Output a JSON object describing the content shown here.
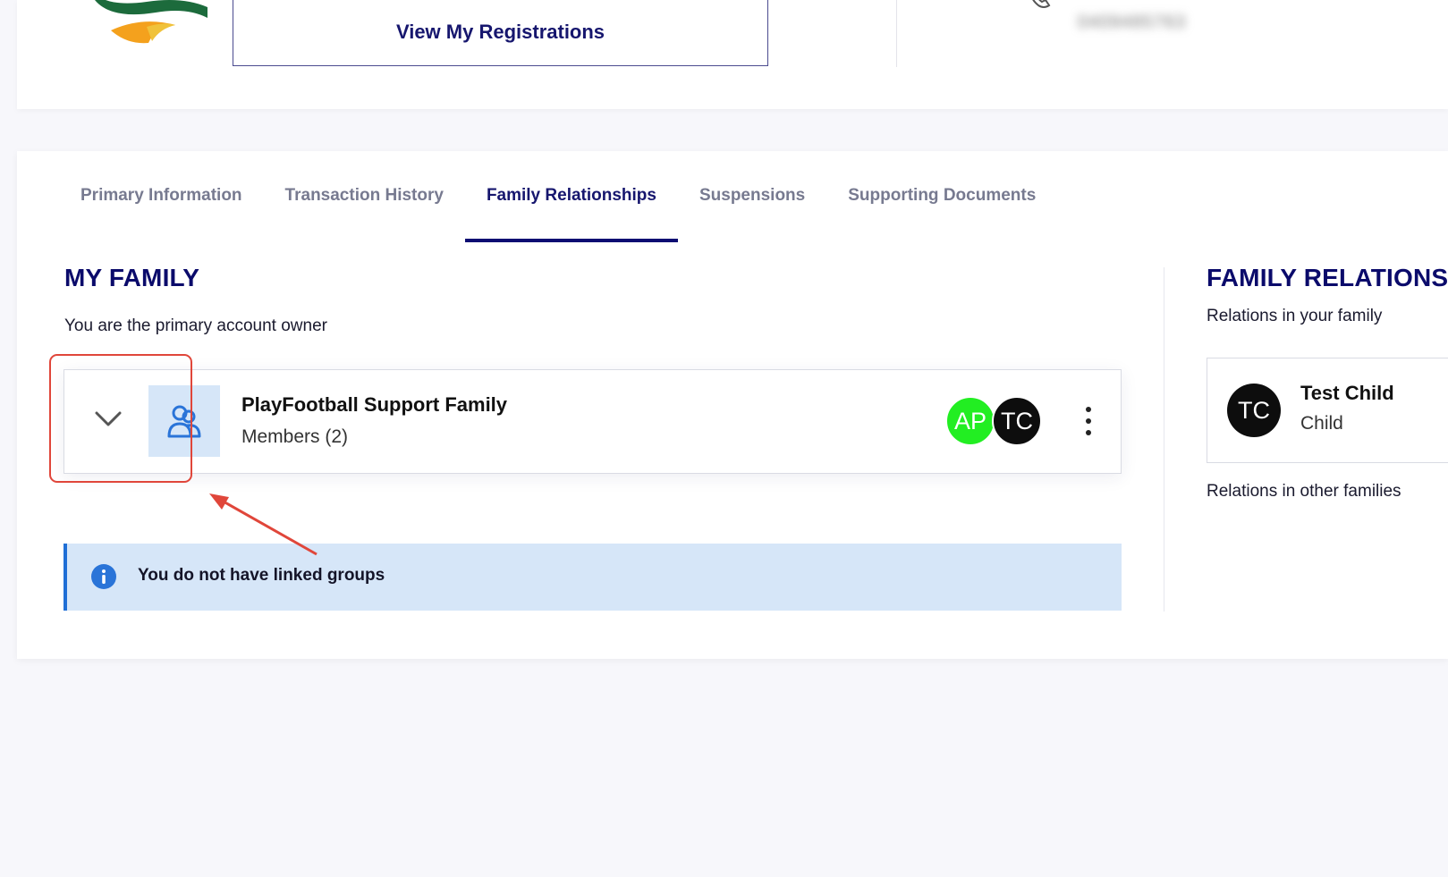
{
  "header": {
    "registrations_button": "View My Registrations",
    "phone_blurred": "0409485763"
  },
  "tabs": [
    {
      "label": "Primary Information",
      "active": false
    },
    {
      "label": "Transaction History",
      "active": false
    },
    {
      "label": "Family Relationships",
      "active": true
    },
    {
      "label": "Suspensions",
      "active": false
    },
    {
      "label": "Supporting Documents",
      "active": false
    }
  ],
  "my_family": {
    "title": "MY FAMILY",
    "owner_note": "You are the primary account owner",
    "family": {
      "name": "PlayFootball Support Family",
      "members": "Members (2)",
      "avatars": [
        {
          "initials": "AP",
          "color": "#22ee22"
        },
        {
          "initials": "TC",
          "color": "#0d0d0d"
        }
      ]
    },
    "alert": "You do not have linked groups"
  },
  "family_relations": {
    "title": "FAMILY RELATIONS",
    "in_family_label": "Relations in your family",
    "relations": [
      {
        "initials": "TC",
        "name": "Test Child",
        "role": "Child"
      }
    ],
    "other_families_label": "Relations in other families"
  },
  "colors": {
    "brand_navy": "#0b0b6b",
    "alert_bg": "#d6e6f8",
    "alert_accent": "#1f6fd6",
    "highlight_annotation": "#e0463a"
  }
}
